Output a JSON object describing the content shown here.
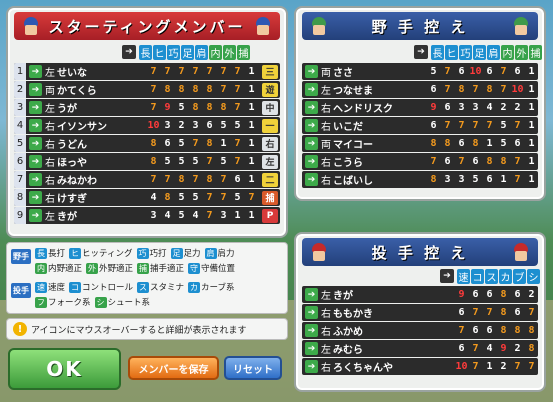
{
  "colors": {
    "stat_white": "#ffffff",
    "stat_orange": "#f39a1e",
    "stat_red": "#ff3b3b"
  },
  "starting": {
    "title": "スターティングメンバー",
    "columns": [
      "長",
      "ヒ",
      "巧",
      "足",
      "肩",
      "内",
      "外",
      "捕"
    ],
    "players": [
      {
        "num": "1",
        "hand": "左",
        "name": "せいな",
        "stats": [
          "7",
          "7",
          "7",
          "7",
          "7",
          "7",
          "7",
          "1"
        ],
        "pos": "三"
      },
      {
        "num": "2",
        "hand": "両",
        "name": "かてくら",
        "stats": [
          "7",
          "8",
          "8",
          "8",
          "8",
          "7",
          "7",
          "1"
        ],
        "pos": "遊"
      },
      {
        "num": "3",
        "hand": "左",
        "name": "うが",
        "stats": [
          "7",
          "9",
          "5",
          "8",
          "8",
          "8",
          "7",
          "1"
        ],
        "pos": "中"
      },
      {
        "num": "4",
        "hand": "右",
        "name": "イソンサン",
        "stats": [
          "10",
          "3",
          "2",
          "3",
          "6",
          "5",
          "5",
          "1"
        ],
        "pos": "一"
      },
      {
        "num": "5",
        "hand": "右",
        "name": "うどん",
        "stats": [
          "8",
          "6",
          "5",
          "7",
          "8",
          "1",
          "7",
          "1"
        ],
        "pos": "右"
      },
      {
        "num": "6",
        "hand": "右",
        "name": "ほっや",
        "stats": [
          "8",
          "5",
          "5",
          "5",
          "7",
          "5",
          "7",
          "1"
        ],
        "pos": "左"
      },
      {
        "num": "7",
        "hand": "右",
        "name": "みねかわ",
        "stats": [
          "7",
          "7",
          "8",
          "7",
          "8",
          "7",
          "6",
          "1"
        ],
        "pos": "二"
      },
      {
        "num": "8",
        "hand": "右",
        "name": "けすぎ",
        "stats": [
          "4",
          "8",
          "5",
          "5",
          "7",
          "7",
          "5",
          "7"
        ],
        "pos": "捕"
      },
      {
        "num": "9",
        "hand": "左",
        "name": "きが",
        "stats": [
          "3",
          "4",
          "5",
          "4",
          "7",
          "3",
          "1",
          "1"
        ],
        "pos": "P"
      }
    ]
  },
  "bench": {
    "title": "野 手 控 え",
    "columns": [
      "長",
      "ヒ",
      "巧",
      "足",
      "肩",
      "内",
      "外",
      "捕"
    ],
    "players": [
      {
        "hand": "両",
        "name": "ささ",
        "stats": [
          "5",
          "7",
          "6",
          "10",
          "6",
          "7",
          "6",
          "1"
        ]
      },
      {
        "hand": "左",
        "name": "つなせま",
        "stats": [
          "6",
          "7",
          "8",
          "7",
          "8",
          "7",
          "10",
          "1"
        ]
      },
      {
        "hand": "右",
        "name": "ヘンドリスク",
        "stats": [
          "9",
          "6",
          "3",
          "3",
          "4",
          "2",
          "2",
          "1"
        ]
      },
      {
        "hand": "右",
        "name": "いこだ",
        "stats": [
          "6",
          "7",
          "7",
          "7",
          "7",
          "5",
          "7",
          "1"
        ]
      },
      {
        "hand": "両",
        "name": "マイコー",
        "stats": [
          "8",
          "8",
          "6",
          "8",
          "1",
          "5",
          "6",
          "1"
        ]
      },
      {
        "hand": "右",
        "name": "こうら",
        "stats": [
          "7",
          "6",
          "7",
          "6",
          "8",
          "8",
          "7",
          "1"
        ]
      },
      {
        "hand": "右",
        "name": "こばいし",
        "stats": [
          "8",
          "3",
          "3",
          "5",
          "6",
          "1",
          "7",
          "1"
        ]
      }
    ]
  },
  "pitchers": {
    "title": "投 手 控 え",
    "columns": [
      "速",
      "コ",
      "ス",
      "カ",
      "ブ",
      "シ"
    ],
    "players": [
      {
        "hand": "左",
        "name": "きが",
        "stats": [
          "9",
          "6",
          "6",
          "8",
          "6",
          "2"
        ]
      },
      {
        "hand": "右",
        "name": "ももかき",
        "stats": [
          "6",
          "7",
          "7",
          "8",
          "6",
          "7"
        ]
      },
      {
        "hand": "右",
        "name": "ふかめ",
        "stats": [
          "7",
          "6",
          "6",
          "8",
          "8",
          "8"
        ]
      },
      {
        "hand": "左",
        "name": "みむら",
        "stats": [
          "6",
          "7",
          "4",
          "9",
          "2",
          "8"
        ]
      },
      {
        "hand": "右",
        "name": "ろくちゃんや",
        "stats": [
          "10",
          "7",
          "1",
          "2",
          "7",
          "7"
        ]
      }
    ]
  },
  "legend": {
    "fielder_tag": "野手",
    "pitcher_tag": "投手",
    "line1": [
      {
        "k": "長",
        "t": "長打"
      },
      {
        "k": "ヒ",
        "t": "ヒッティング"
      },
      {
        "k": "巧",
        "t": "巧打"
      },
      {
        "k": "足",
        "t": "足力"
      },
      {
        "k": "肩",
        "t": "肩力"
      }
    ],
    "line2": [
      {
        "k": "内",
        "t": "内野適正"
      },
      {
        "k": "外",
        "t": "外野適正"
      },
      {
        "k": "捕",
        "t": "捕手適正"
      },
      {
        "k": "守",
        "t": "守備位置"
      }
    ],
    "line3": [
      {
        "k": "速",
        "t": "速度"
      },
      {
        "k": "コ",
        "t": "コントロール"
      },
      {
        "k": "ス",
        "t": "スタミナ"
      },
      {
        "k": "カ",
        "t": "カーブ系"
      }
    ],
    "line4": [
      {
        "k": "フ",
        "t": "フォーク系"
      },
      {
        "k": "シ",
        "t": "シュート系"
      }
    ]
  },
  "notice": "アイコンにマウスオーバーすると詳細が表示されます",
  "buttons": {
    "ok": "OK",
    "save": "メンバーを保存",
    "reset": "リセット"
  }
}
